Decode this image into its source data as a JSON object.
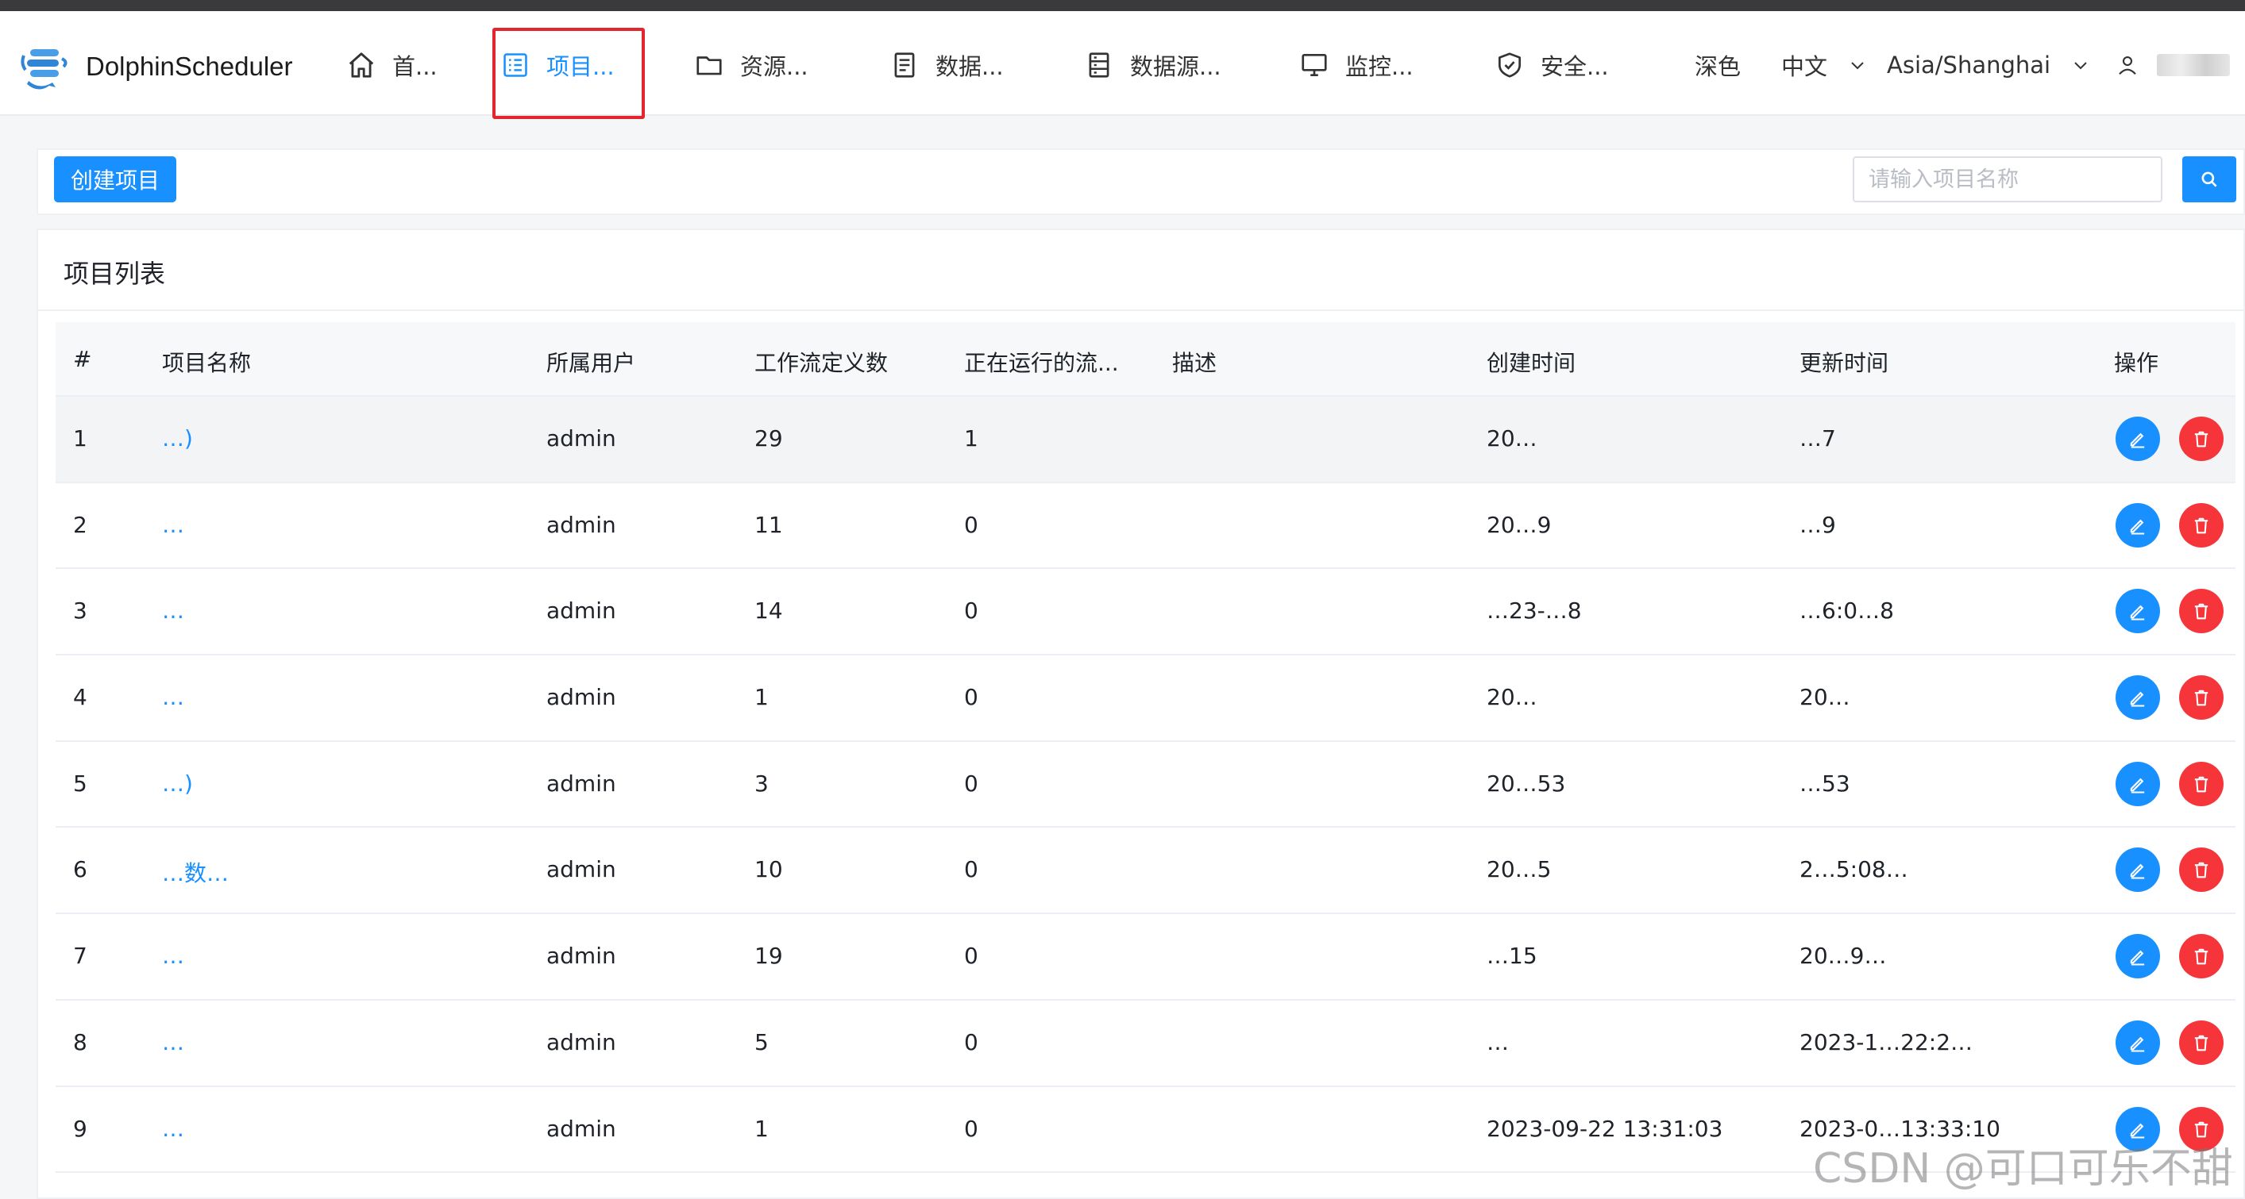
{
  "app": {
    "name": "DolphinScheduler"
  },
  "nav": {
    "items": [
      {
        "label": "首...",
        "icon": "home-icon"
      },
      {
        "label": "项目...",
        "icon": "project-list-icon",
        "active": true
      },
      {
        "label": "资源...",
        "icon": "folder-icon"
      },
      {
        "label": "数据...",
        "icon": "document-icon"
      },
      {
        "label": "数据源...",
        "icon": "datasource-icon"
      },
      {
        "label": "监控...",
        "icon": "monitor-icon"
      },
      {
        "label": "安全...",
        "icon": "shield-icon"
      }
    ],
    "theme": "深色",
    "language": "中文",
    "timezone": "Asia/Shanghai"
  },
  "toolbar": {
    "create_label": "创建项目",
    "search_placeholder": "请输入项目名称"
  },
  "card": {
    "title": "项目列表"
  },
  "table": {
    "headers": [
      "#",
      "项目名称",
      "所属用户",
      "工作流定义数",
      "正在运行的流...",
      "描述",
      "创建时间",
      "更新时间",
      "操作"
    ],
    "rows": [
      {
        "index": "1",
        "name": "…)",
        "owner": "admin",
        "workflow_count": "29",
        "running": "1",
        "created": "20…",
        "updated": "…7"
      },
      {
        "index": "2",
        "name": "…",
        "owner": "admin",
        "workflow_count": "11",
        "running": "0",
        "created": "20…9",
        "updated": "…9"
      },
      {
        "index": "3",
        "name": "…",
        "owner": "admin",
        "workflow_count": "14",
        "running": "0",
        "created": "…23-…8",
        "updated": "…6:0…8"
      },
      {
        "index": "4",
        "name": "…",
        "owner": "admin",
        "workflow_count": "1",
        "running": "0",
        "created": "20…",
        "updated": "20…"
      },
      {
        "index": "5",
        "name": "…)",
        "owner": "admin",
        "workflow_count": "3",
        "running": "0",
        "created": "20…53",
        "updated": "…53"
      },
      {
        "index": "6",
        "name": "…数…",
        "owner": "admin",
        "workflow_count": "10",
        "running": "0",
        "created": "20…5",
        "updated": "2…5:08…"
      },
      {
        "index": "7",
        "name": "…",
        "owner": "admin",
        "workflow_count": "19",
        "running": "0",
        "created": "…15",
        "updated": "20…9…"
      },
      {
        "index": "8",
        "name": "…",
        "owner": "admin",
        "workflow_count": "5",
        "running": "0",
        "created": "…",
        "updated": "2023-1…22:2…"
      },
      {
        "index": "9",
        "name": "…",
        "owner": "admin",
        "workflow_count": "1",
        "running": "0",
        "created": "2023-09-22 13:31:03",
        "updated": "2023-0…13:33:10"
      }
    ]
  },
  "watermark": "CSDN @可口可乐不甜",
  "colors": {
    "accent": "#1890ff",
    "danger": "#f5353a",
    "highlight_box": "#e3262d"
  }
}
